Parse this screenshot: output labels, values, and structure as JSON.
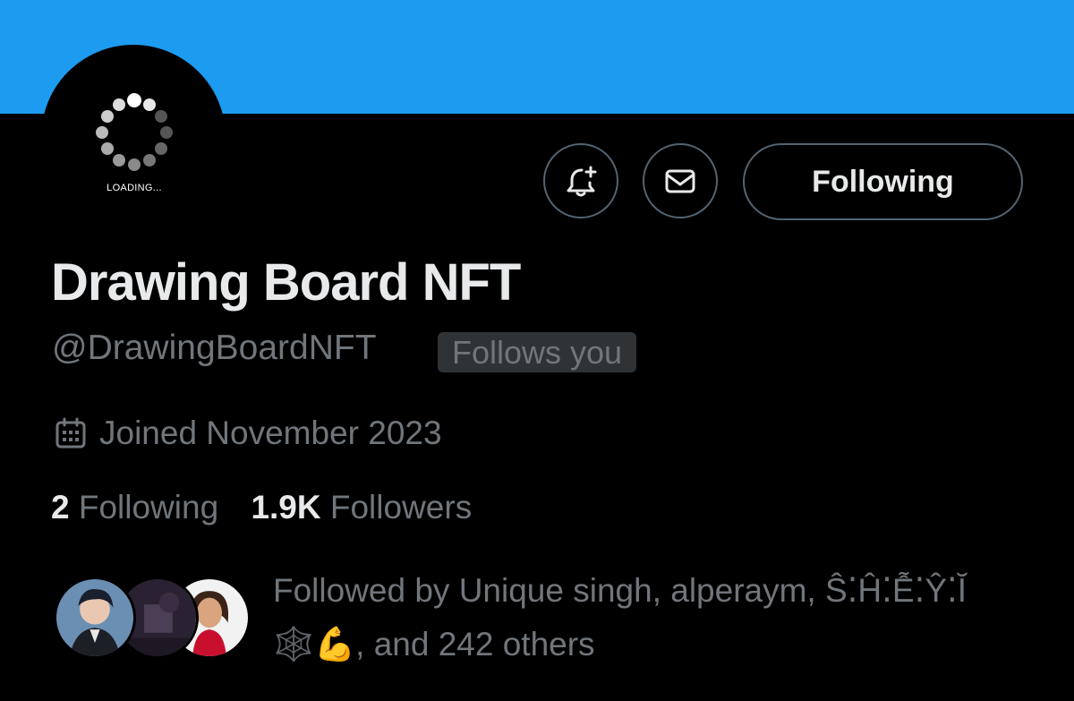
{
  "banner": {
    "color": "#1d9bf0"
  },
  "avatar": {
    "loading_label": "LOADING..."
  },
  "actions": {
    "bell_icon": "bell-plus-icon",
    "mail_icon": "envelope-icon",
    "following_label": "Following"
  },
  "profile": {
    "display_name": "Drawing Board NFT",
    "handle": "@DrawingBoardNFT",
    "follows_you": "Follows you",
    "joined": "Joined November 2023",
    "calendar_icon": "calendar-icon"
  },
  "stats": {
    "following_count": "2",
    "following_label": "Following",
    "followers_count": "1.9K",
    "followers_label": "Followers"
  },
  "followed_by": {
    "line1": "Followed by Unique singh, alperaym, Ŝ⁚Ĥ⁚Ễ⁚Ŷ⁚Ĭ",
    "line2": "🕸️💪, and 242 others"
  },
  "colors": {
    "background": "#000000",
    "primary_text": "#e7e9ea",
    "secondary_text": "#71767b",
    "border": "#536471",
    "badge_bg": "#2f3336"
  }
}
